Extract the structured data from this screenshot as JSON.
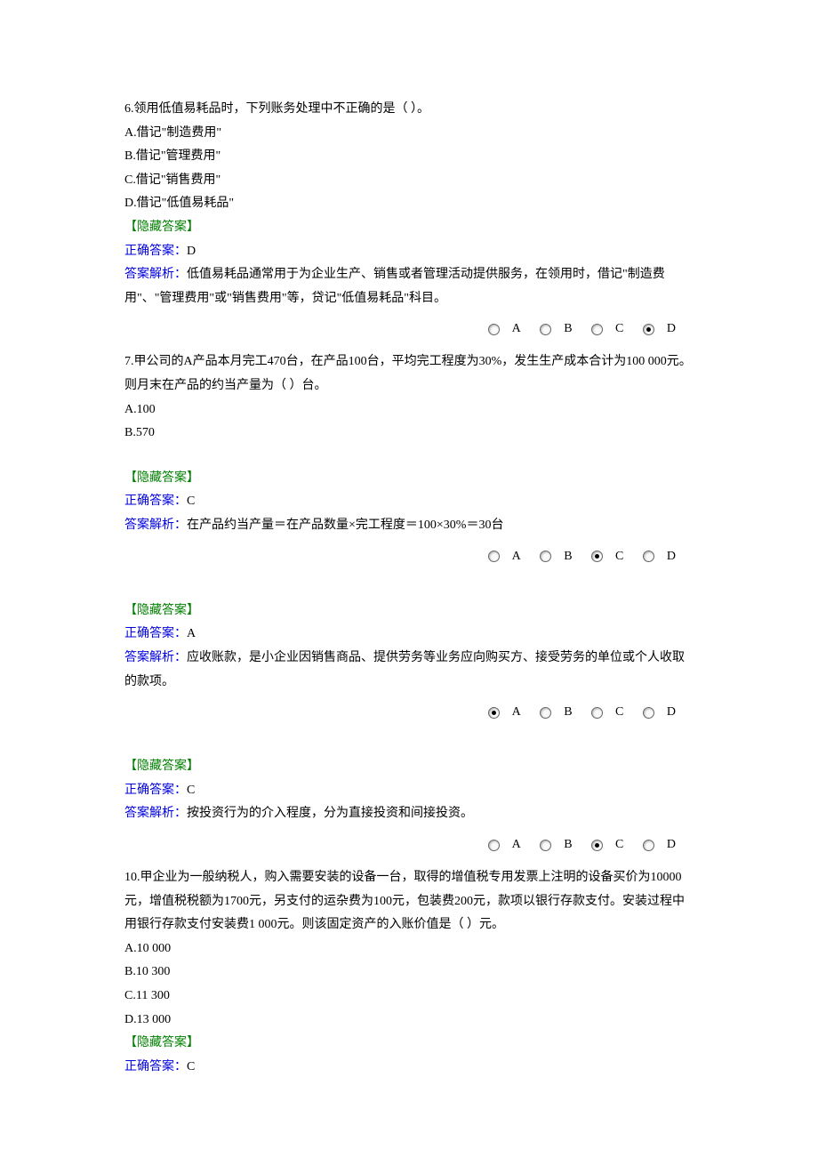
{
  "q6": {
    "text": "6.领用低值易耗品时，下列账务处理中不正确的是（ ）。",
    "optA": "A.借记\"制造费用\"",
    "optB": "B.借记\"管理费用\"",
    "optC": "C.借记\"销售费用\"",
    "optD": "D.借记\"低值易耗品\"",
    "hide": "【隐藏答案】",
    "correct_label": "正确答案：",
    "correct_value": "D",
    "analysis_label": "答案解析：",
    "analysis_text": "低值易耗品通常用于为企业生产、销售或者管理活动提供服务，在领用时，借记\"制造费用\"、\"管理费用\"或\"销售费用\"等，贷记\"低值易耗品\"科目。",
    "radios": {
      "A": "A",
      "B": "B",
      "C": "C",
      "D": "D",
      "selected": "D"
    }
  },
  "q7": {
    "text": "7.甲公司的A产品本月完工470台，在产品100台，平均完工程度为30%，发生生产成本合计为100 000元。则月末在产品的约当产量为（   ）台。",
    "optA": "A.100",
    "optB": "B.570",
    "hide": "【隐藏答案】",
    "correct_label": "正确答案：",
    "correct_value": "C",
    "analysis_label": "答案解析：",
    "analysis_text": "在产品约当产量＝在产品数量×完工程度＝100×30%＝30台",
    "radios": {
      "A": "A",
      "B": "B",
      "C": "C",
      "D": "D",
      "selected": "C"
    }
  },
  "q8": {
    "hide": "【隐藏答案】",
    "correct_label": "正确答案：",
    "correct_value": "A",
    "analysis_label": "答案解析：",
    "analysis_text": "应收账款，是小企业因销售商品、提供劳务等业务应向购买方、接受劳务的单位或个人收取的款项。",
    "radios": {
      "A": "A",
      "B": "B",
      "C": "C",
      "D": "D",
      "selected": "A"
    }
  },
  "q9": {
    "hide": "【隐藏答案】",
    "correct_label": "正确答案：",
    "correct_value": "C",
    "analysis_label": "答案解析：",
    "analysis_text": "按投资行为的介入程度，分为直接投资和间接投资。",
    "radios": {
      "A": "A",
      "B": "B",
      "C": "C",
      "D": "D",
      "selected": "C"
    }
  },
  "q10": {
    "text": "10.甲企业为一般纳税人，购入需要安装的设备一台，取得的增值税专用发票上注明的设备买价为10000元，增值税税额为1700元，另支付的运杂费为100元，包装费200元，款项以银行存款支付。安装过程中用银行存款支付安装费1 000元。则该固定资产的入账价值是（    ）元。",
    "optA": "A.10 000",
    "optB": "B.10 300",
    "optC": "C.11 300",
    "optD": "D.13 000",
    "hide": "【隐藏答案】",
    "correct_label": "正确答案：",
    "correct_value": "C"
  }
}
